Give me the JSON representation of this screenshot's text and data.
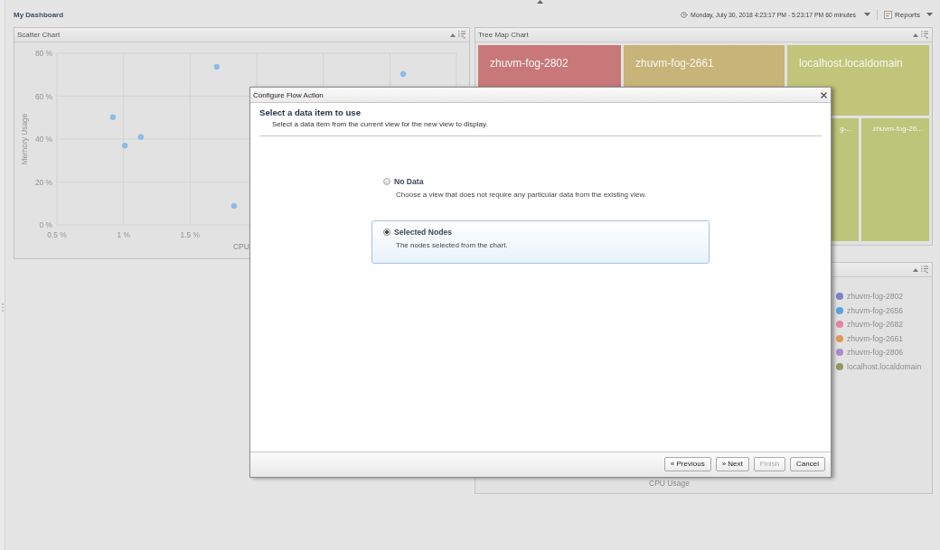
{
  "header": {
    "title": "My Dashboard",
    "time_range": "Monday, July 30, 2018 4:23:17 PM - 5:23:17 PM 60 minutes",
    "reports": "Reports"
  },
  "scatter_panel": {
    "title": "Scatter Chart",
    "chart_data": {
      "type": "scatter",
      "xlabel": "CPU",
      "ylabel": "Memory Usage",
      "x": [
        0.92,
        1.01,
        1.13,
        1.7,
        1.83,
        3.1
      ],
      "series": [
        {
          "color": "#8fbbe6",
          "values": [
            50.2,
            37,
            41,
            73.7,
            8.8,
            70.3
          ]
        }
      ],
      "xlim": [
        0.5,
        3.5
      ],
      "ylim": [
        0,
        80
      ],
      "xticks": [
        {
          "value": 0.5,
          "label": "0.5 %"
        },
        {
          "value": 1,
          "label": "1 %"
        },
        {
          "value": 1.5,
          "label": "1.5 %"
        }
      ],
      "yticks": [
        {
          "value": 0,
          "label": "0 %"
        },
        {
          "value": 20,
          "label": "20 %"
        },
        {
          "value": 40,
          "label": "40 %"
        },
        {
          "value": 60,
          "label": "60 %"
        },
        {
          "value": 80,
          "label": "80 %"
        }
      ],
      "grid": true
    }
  },
  "treemap_panel": {
    "title": "Tree Map Chart",
    "tiles": [
      {
        "label": "zhuvm-fog-2802",
        "color": "#c87878",
        "kind": "large"
      },
      {
        "label": "zhuvm-fog-2661",
        "color": "#c8b478",
        "kind": "large"
      },
      {
        "label": "localhost.localdomain",
        "color": "#c2c47a",
        "kind": "large"
      },
      {
        "label": "g-...",
        "color": "#bcc67a",
        "kind": "small"
      },
      {
        "label": "zhuvm-fog-26...",
        "color": "#bcc67a",
        "kind": "small"
      }
    ]
  },
  "usage_panel": {
    "legend": [
      {
        "label": "zhuvm-fog-2802",
        "color": "#7f7fcc"
      },
      {
        "label": "zhuvm-fog-2656",
        "color": "#5ba3dc"
      },
      {
        "label": "zhuvm-fog-2682",
        "color": "#e383a5"
      },
      {
        "label": "zhuvm-fog-2661",
        "color": "#de9a5a"
      },
      {
        "label": "zhuvm-fog-2806",
        "color": "#a88ad0"
      },
      {
        "label": "localhost.localdomain",
        "color": "#8e9a62"
      }
    ],
    "xlabel": "CPU Usage"
  },
  "dialog": {
    "title": "Configure Flow Action",
    "heading": "Select a data item to use",
    "subheading": "Select a data item from the current view for the new view to display.",
    "options": [
      {
        "label": "No Data",
        "description": "Choose a view that does not require any particular data from the existing view.",
        "selected": false
      },
      {
        "label": "Selected Nodes",
        "description": "The nodes selected from the chart.",
        "selected": true
      }
    ],
    "buttons": [
      {
        "label": "« Previous",
        "disabled": false
      },
      {
        "label": "» Next",
        "disabled": false
      },
      {
        "label": "Finish",
        "disabled": true
      },
      {
        "label": "Cancel",
        "disabled": false
      }
    ]
  }
}
